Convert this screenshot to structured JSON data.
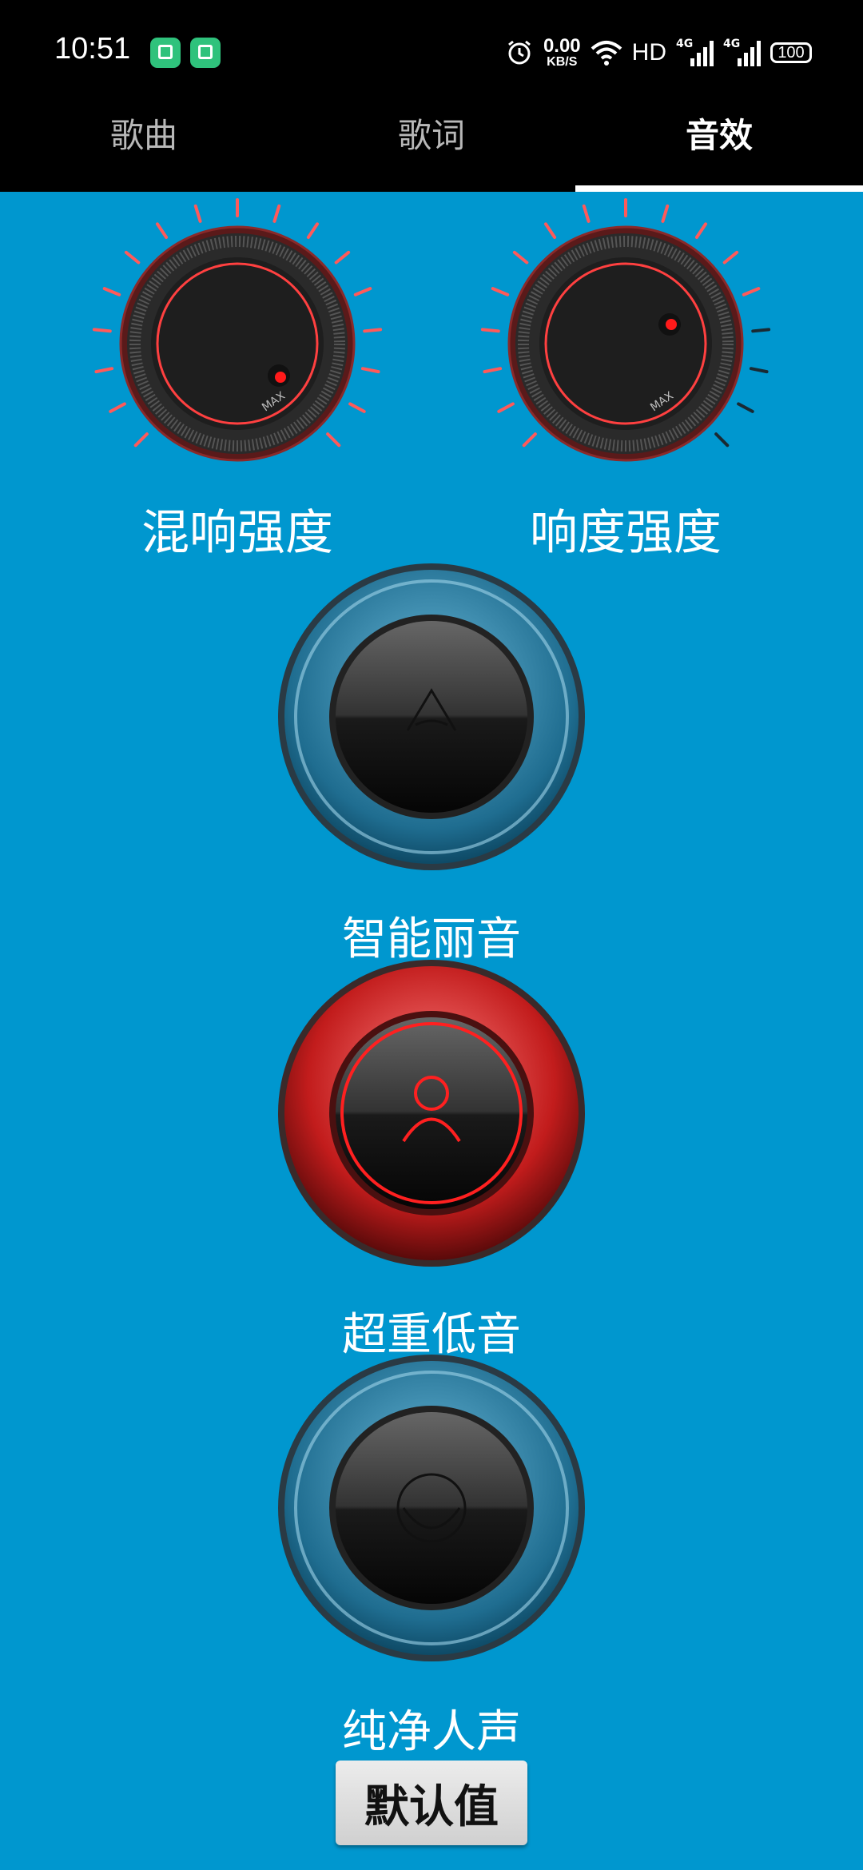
{
  "status": {
    "time": "10:51",
    "speed_value": "0.00",
    "speed_unit": "KB/S",
    "hd": "HD",
    "net1": "4G",
    "net2": "4G",
    "battery": "100",
    "icons": [
      "alarm-icon",
      "wifi-icon"
    ]
  },
  "tabs": [
    {
      "label": "歌曲",
      "active": false
    },
    {
      "label": "歌词",
      "active": false
    },
    {
      "label": "音效",
      "active": true
    }
  ],
  "knobs": [
    {
      "label": "混响强度",
      "max_label": "MAX"
    },
    {
      "label": "响度强度",
      "max_label": "MAX"
    }
  ],
  "modes": [
    {
      "label": "智能丽音",
      "state": "off",
      "icon": "smart-audio-icon"
    },
    {
      "label": "超重低音",
      "state": "on",
      "icon": "person-icon"
    },
    {
      "label": "纯净人声",
      "state": "off",
      "icon": "voice-icon"
    }
  ],
  "default_button": "默认值",
  "colors": {
    "background": "#0097cf",
    "accent_red": "#ff2a2a",
    "tab_bar": "#000000"
  }
}
